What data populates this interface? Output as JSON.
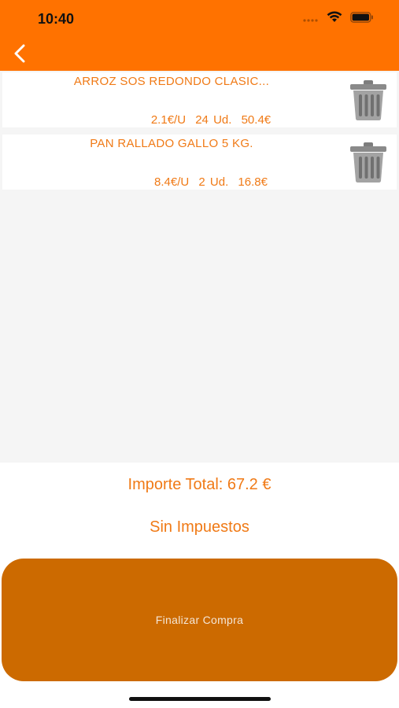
{
  "status_bar": {
    "time": "10:40"
  },
  "nav": {
    "back_icon": "chevron-left-icon"
  },
  "cart": {
    "items": [
      {
        "name": "ARROZ SOS REDONDO CLASIC...",
        "unit_price": "2.1€/U",
        "quantity": "24 Ud.",
        "subtotal": "50.4€"
      },
      {
        "name": "PAN RALLADO GALLO 5 KG.",
        "unit_price": "8.4€/U",
        "quantity": "2 Ud.",
        "subtotal": "16.8€"
      }
    ]
  },
  "summary": {
    "total": "Importe Total: 67.2 €",
    "tax_note": "Sin Impuestos"
  },
  "checkout": {
    "label": "Finalizar Compra"
  },
  "colors": {
    "header": "#FF7200",
    "accent_text": "#F07A16",
    "button": "#CC6A00",
    "list_background": "#F5F5F5"
  }
}
